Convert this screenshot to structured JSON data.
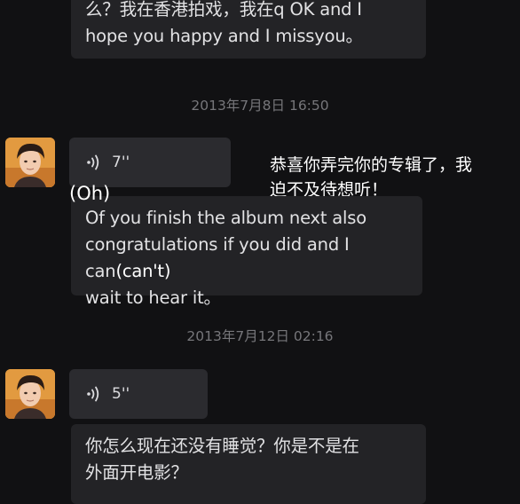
{
  "messages": {
    "top_text": "么？我在香港拍戏，我在q OK and I\nhope you happy and I missyou。",
    "timestamp_1": "2013年7月8日 16:50",
    "voice_1_duration": "7''",
    "subtitle_1": "恭喜你弄完你的专辑了，我\n迫不及待想听！",
    "oh_note": "(Oh)",
    "text_1_main": "Of you finish the album next also\ncongratulations if you did and I can",
    "text_1_note": "(can't)",
    "text_1_tail": "wait to hear it。",
    "timestamp_2": "2013年7月12日 02:16",
    "voice_2_duration": "5''",
    "text_2": "你怎么现在还没有睡觉？你是不是在\n外面开电影？"
  },
  "icons": {
    "voice": "voice-wave-icon",
    "avatar": "contact-avatar"
  },
  "colors": {
    "background": "#111113",
    "bubble": "#232326",
    "voice_bubble": "#2b2b2f",
    "timestamp": "#76767a",
    "avatar_bg": "#e29a40"
  }
}
